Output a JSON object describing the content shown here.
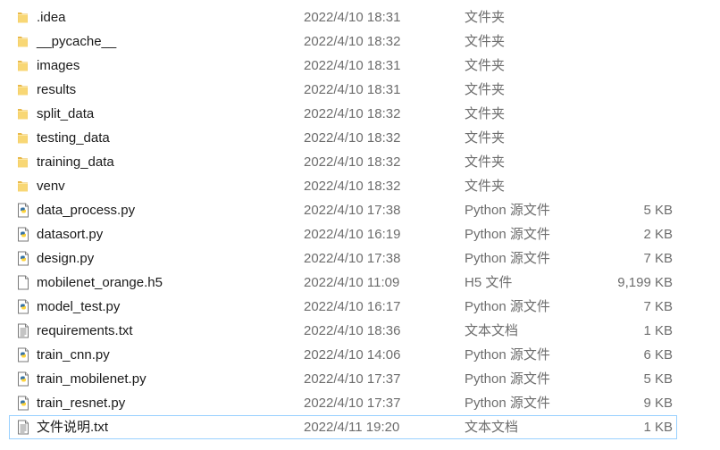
{
  "files": [
    {
      "name": ".idea",
      "date": "2022/4/10 18:31",
      "type": "文件夹",
      "size": "",
      "icon": "folder-icon"
    },
    {
      "name": "__pycache__",
      "date": "2022/4/10 18:32",
      "type": "文件夹",
      "size": "",
      "icon": "folder-icon"
    },
    {
      "name": "images",
      "date": "2022/4/10 18:31",
      "type": "文件夹",
      "size": "",
      "icon": "folder-icon"
    },
    {
      "name": "results",
      "date": "2022/4/10 18:31",
      "type": "文件夹",
      "size": "",
      "icon": "folder-icon"
    },
    {
      "name": "split_data",
      "date": "2022/4/10 18:32",
      "type": "文件夹",
      "size": "",
      "icon": "folder-icon"
    },
    {
      "name": "testing_data",
      "date": "2022/4/10 18:32",
      "type": "文件夹",
      "size": "",
      "icon": "folder-icon"
    },
    {
      "name": "training_data",
      "date": "2022/4/10 18:32",
      "type": "文件夹",
      "size": "",
      "icon": "folder-icon"
    },
    {
      "name": "venv",
      "date": "2022/4/10 18:32",
      "type": "文件夹",
      "size": "",
      "icon": "folder-icon"
    },
    {
      "name": "data_process.py",
      "date": "2022/4/10 17:38",
      "type": "Python 源文件",
      "size": "5 KB",
      "icon": "python-file-icon"
    },
    {
      "name": "datasort.py",
      "date": "2022/4/10 16:19",
      "type": "Python 源文件",
      "size": "2 KB",
      "icon": "python-file-icon"
    },
    {
      "name": "design.py",
      "date": "2022/4/10 17:38",
      "type": "Python 源文件",
      "size": "7 KB",
      "icon": "python-file-icon"
    },
    {
      "name": "mobilenet_orange.h5",
      "date": "2022/4/10 11:09",
      "type": "H5 文件",
      "size": "9,199 KB",
      "icon": "blank-file-icon"
    },
    {
      "name": "model_test.py",
      "date": "2022/4/10 16:17",
      "type": "Python 源文件",
      "size": "7 KB",
      "icon": "python-file-icon"
    },
    {
      "name": "requirements.txt",
      "date": "2022/4/10 18:36",
      "type": "文本文档",
      "size": "1 KB",
      "icon": "text-file-icon"
    },
    {
      "name": "train_cnn.py",
      "date": "2022/4/10 14:06",
      "type": "Python 源文件",
      "size": "6 KB",
      "icon": "python-file-icon"
    },
    {
      "name": "train_mobilenet.py",
      "date": "2022/4/10 17:37",
      "type": "Python 源文件",
      "size": "5 KB",
      "icon": "python-file-icon"
    },
    {
      "name": "train_resnet.py",
      "date": "2022/4/10 17:37",
      "type": "Python 源文件",
      "size": "9 KB",
      "icon": "python-file-icon"
    },
    {
      "name": "文件说明.txt",
      "date": "2022/4/11 19:20",
      "type": "文本文档",
      "size": "1 KB",
      "icon": "text-file-icon",
      "selected": true
    }
  ],
  "colors": {
    "text": "#1a1a1a",
    "meta_text": "#6d6d6d",
    "selection_border": "#99d1ff",
    "folder_yellow": "#f8d775",
    "python_blue": "#3572a5",
    "python_yellow": "#ffd43b"
  }
}
